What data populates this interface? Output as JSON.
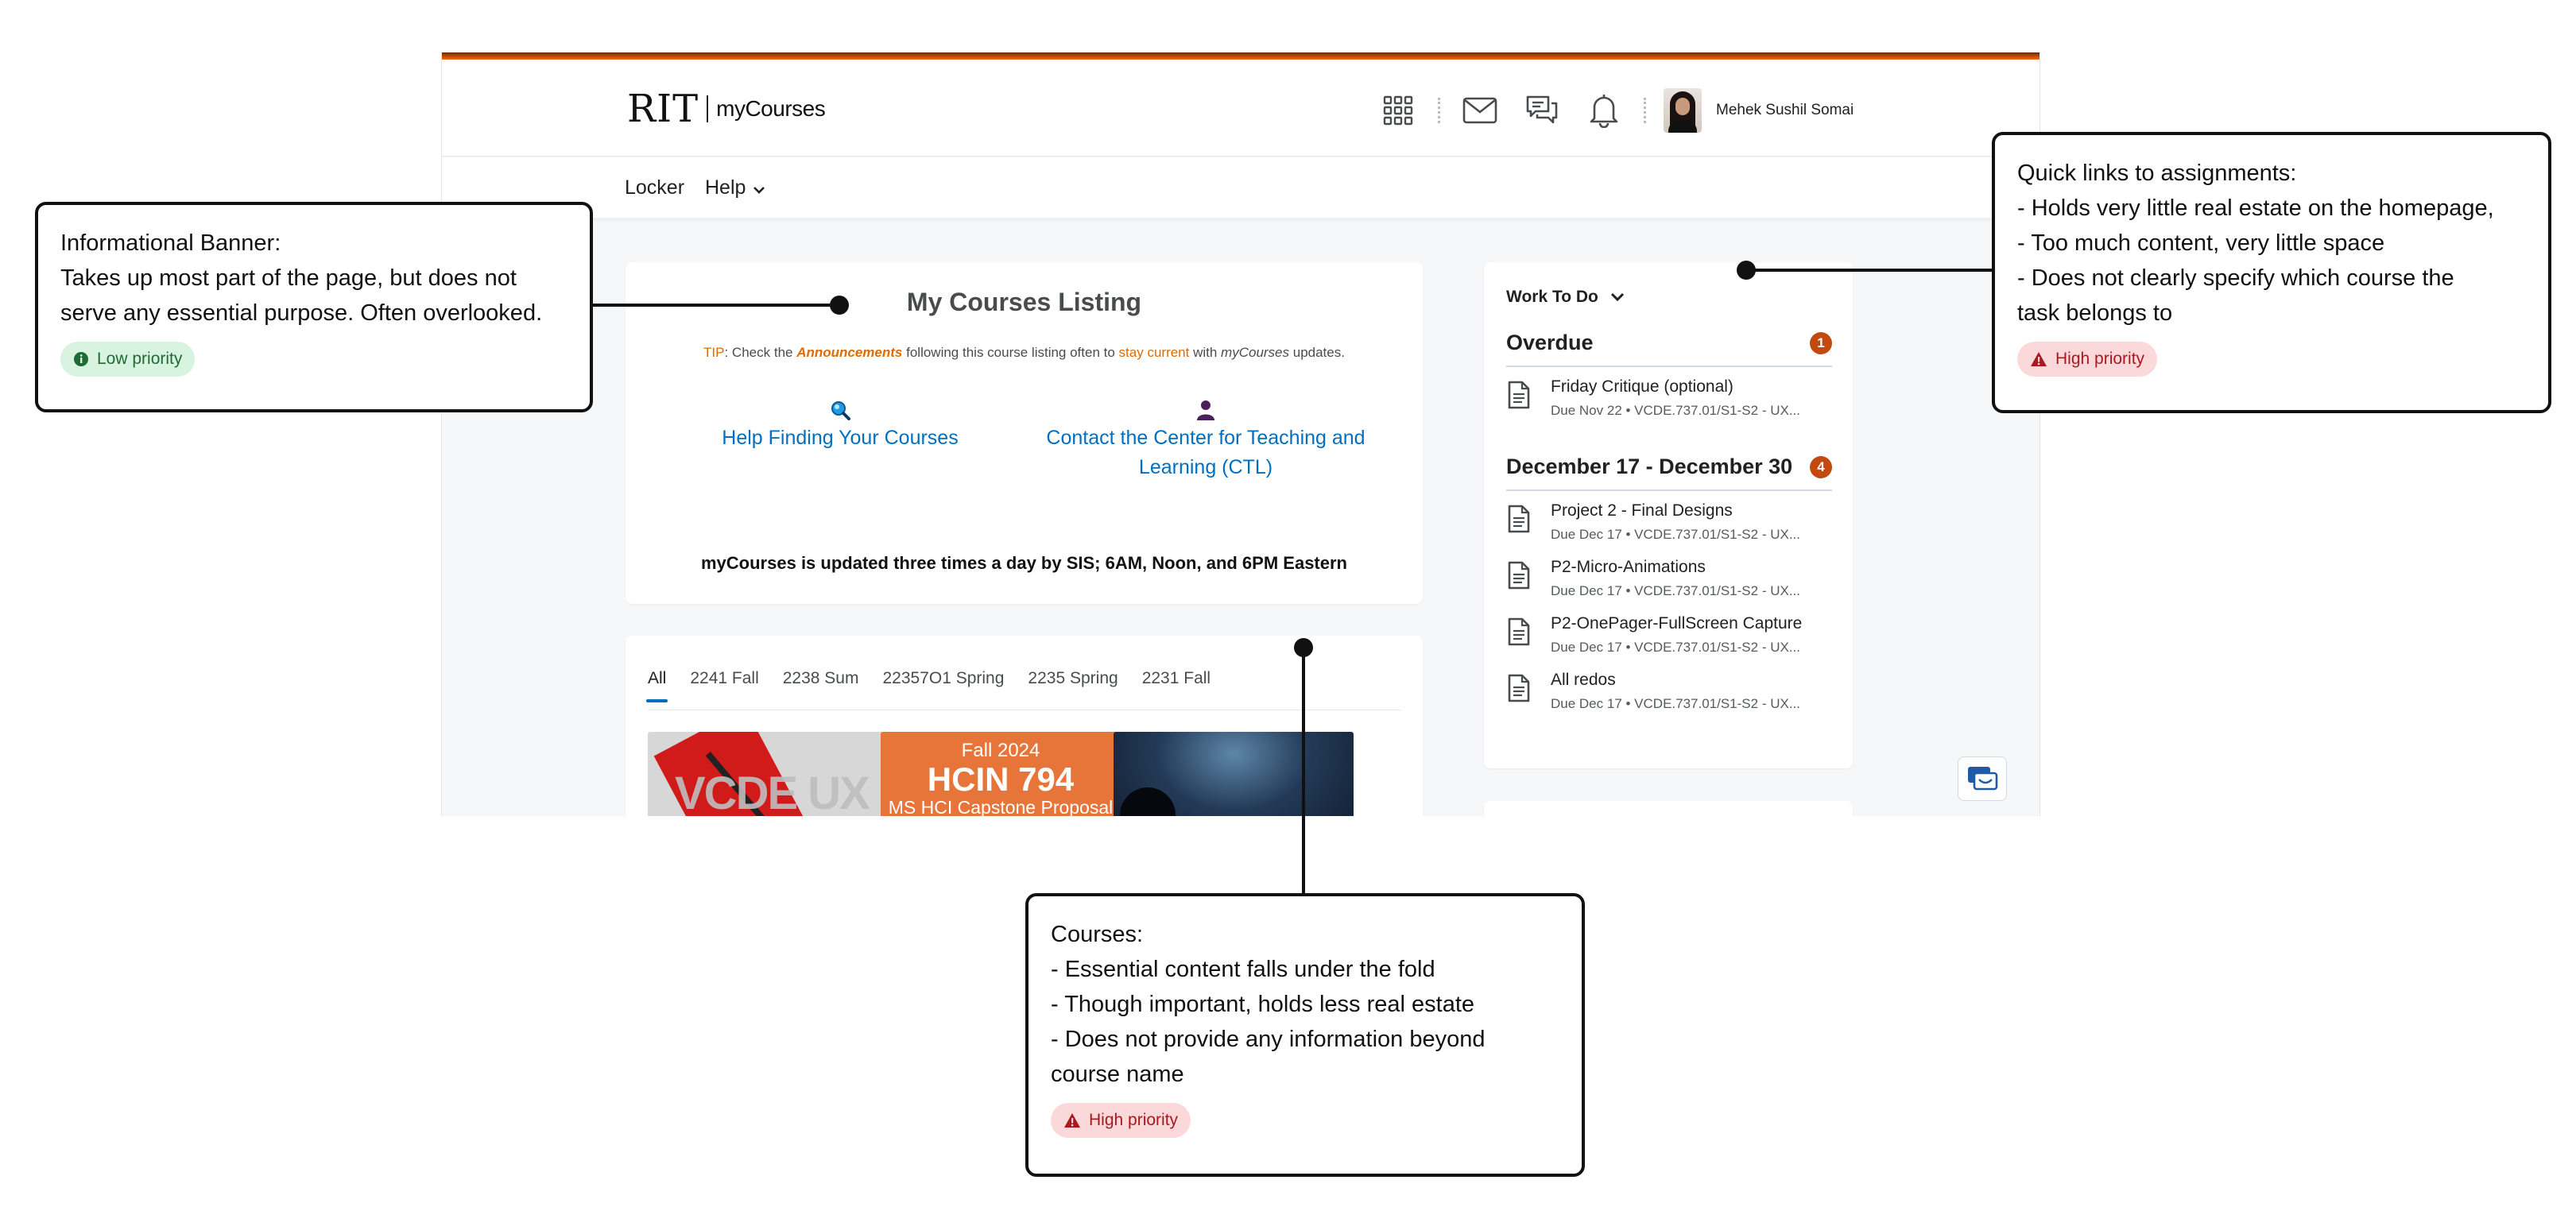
{
  "brand": {
    "logo_main": "RIT",
    "logo_sub": "myCourses"
  },
  "header": {
    "icons": [
      "apps-grid-icon",
      "mail-icon",
      "chat-bubbles-icon",
      "bell-icon"
    ],
    "user_name": "Mehek Sushil Somai"
  },
  "nav": {
    "locker": "Locker",
    "help": "Help"
  },
  "listing": {
    "title": "My Courses Listing",
    "tip_label": "TIP",
    "tip_text_1": ": Check the ",
    "tip_announcements": "Announcements",
    "tip_text_2": " following this course listing often to ",
    "tip_stay_current": "stay current",
    "tip_text_3": " with ",
    "tip_mycourses": "myCourses",
    "tip_text_4": " updates.",
    "link_help": "Help Finding Your Courses",
    "link_ctl": "Contact the Center for Teaching and Learning (CTL)",
    "updated_text": "myCourses is updated three times a day by SIS; 6AM, Noon, and 6PM Eastern"
  },
  "courses": {
    "tabs": [
      "All",
      "2241 Fall",
      "2238 Sum",
      "22357O1 Spring",
      "2235 Spring",
      "2231 Fall"
    ],
    "active_tab": "All",
    "tiles": [
      {
        "image_text": "VCDE UX"
      },
      {
        "term": "Fall 2024",
        "code": "HCIN 794",
        "name": "MS HCI Capstone Proposal"
      },
      {
        "image_text": ""
      }
    ]
  },
  "work": {
    "title": "Work To Do",
    "overdue": {
      "title": "Overdue",
      "count": "1",
      "items": [
        {
          "name": "Friday Critique (optional)",
          "due": "Due Nov 22 • VCDE.737.01/S1-S2 - UX..."
        }
      ]
    },
    "upcoming": {
      "title": "December 17 - December 30",
      "count": "4",
      "items": [
        {
          "name": "Project 2 - Final Designs",
          "due": "Due Dec 17 • VCDE.737.01/S1-S2 - UX..."
        },
        {
          "name": "P2-Micro-Animations",
          "due": "Due Dec 17 • VCDE.737.01/S1-S2 - UX..."
        },
        {
          "name": "P2-OnePager-FullScreen Capture",
          "due": "Due Dec 17 • VCDE.737.01/S1-S2 - UX..."
        },
        {
          "name": "All redos",
          "due": "Due Dec 17 • VCDE.737.01/S1-S2 - UX..."
        }
      ]
    }
  },
  "annotations": {
    "banner": {
      "lines": [
        "Informational Banner:",
        "Takes up most part of the page, but does not",
        "serve any essential purpose. Often overlooked."
      ],
      "priority": "Low priority"
    },
    "quick_links": {
      "lines": [
        "Quick links to assignments:",
        "- Holds very little real estate on the homepage,",
        "- Too much content, very little space",
        "- Does not clearly specify which course the",
        "task belongs to"
      ],
      "priority": "High priority"
    },
    "courses": {
      "lines": [
        "Courses:",
        "- Essential content falls under the fold",
        "- Though important, holds less real estate",
        "- Does not provide any information beyond",
        "course name"
      ],
      "priority": "High priority"
    }
  },
  "colors": {
    "accent_orange": "#f76902",
    "link_blue": "#006fbf",
    "badge_orange": "#c24a0f",
    "high_bg": "#fbd9da",
    "low_bg": "#d8f3df"
  }
}
